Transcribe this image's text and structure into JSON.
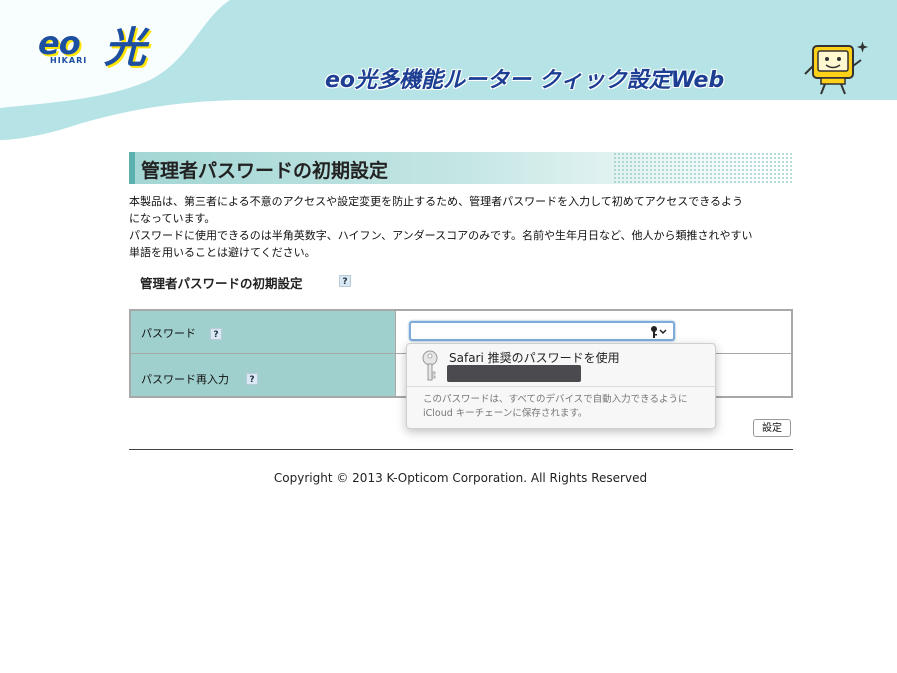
{
  "header": {
    "logo_main": "eo",
    "logo_kanji": "光",
    "logo_sub": "HIKARI",
    "app_title": "eo光多機能ルーター クィック設定Web"
  },
  "section": {
    "title": "管理者パスワードの初期設定",
    "description": [
      "本製品は、第三者による不意のアクセスや設定変更を防止するため、管理者パスワードを入力して初めてアクセスできるよう",
      "になっています。",
      "パスワードに使用できるのは半角英数字、ハイフン、アンダースコアのみです。名前や生年月日など、他人から類推されやすい",
      "単語を用いることは避けてください。"
    ],
    "subheading": "管理者パスワードの初期設定",
    "help_label": "?"
  },
  "form": {
    "password_label": "パスワード",
    "password_confirm_label": "パスワード再入力",
    "submit_label": "設定"
  },
  "autofill": {
    "title": "Safari 推奨のパスワードを使用",
    "note": "このパスワードは、すべてのデバイスで自動入力できるように iCloud キーチェーンに保存されます。"
  },
  "footer": {
    "copyright": "Copyright © 2013 K-Opticom Corporation. All Rights Reserved"
  },
  "colors": {
    "header_bg": "#b5e3e6",
    "table_label_bg": "#9fd0cd",
    "title_blue": "#1d3f93",
    "logo_yellow": "#ffe600"
  }
}
